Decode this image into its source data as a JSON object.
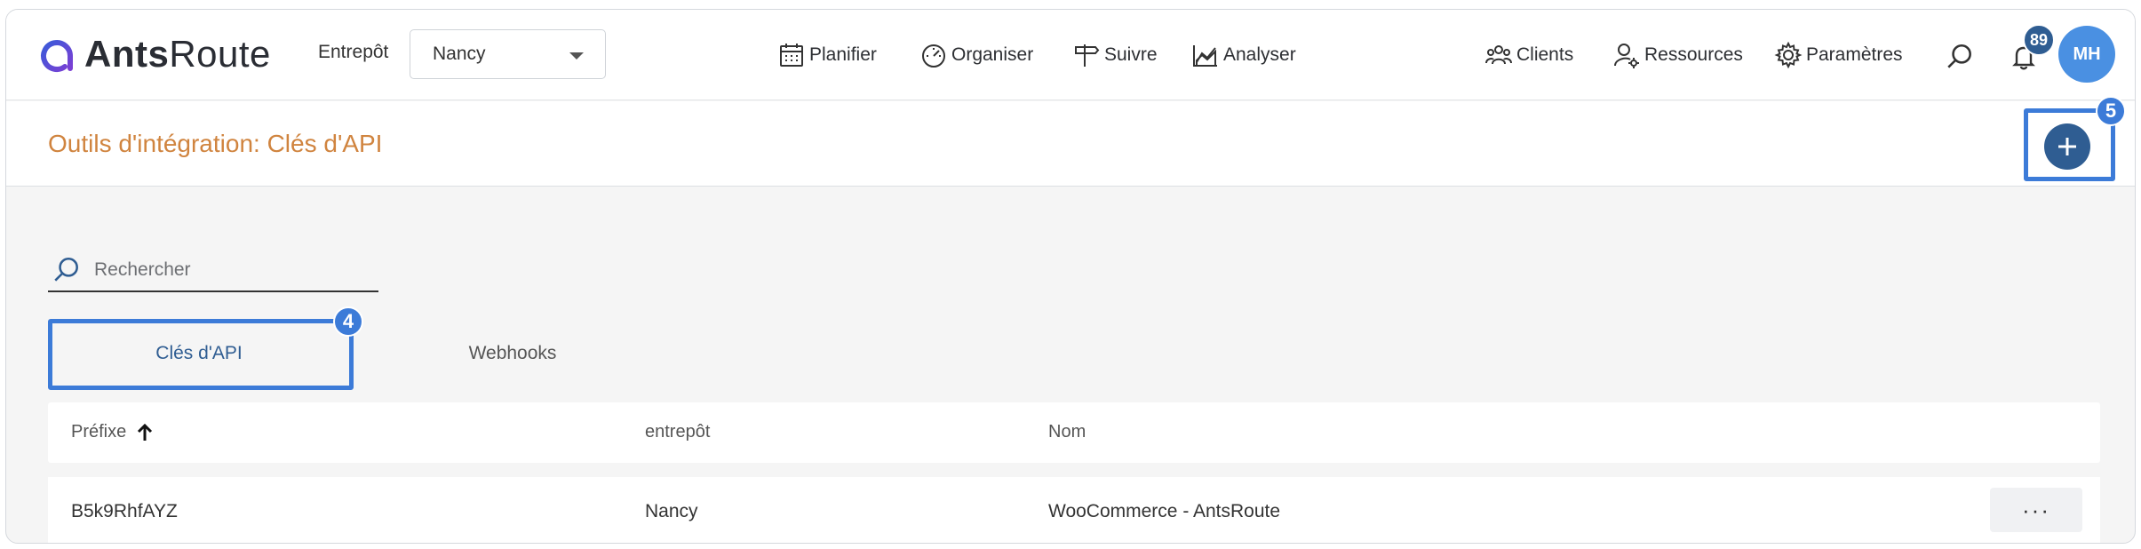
{
  "brand": {
    "logo_bold": "Ants",
    "logo_light": "Route"
  },
  "header": {
    "warehouse_label": "Entrepôt",
    "warehouse_value": "Nancy",
    "nav": [
      {
        "label": "Planifier",
        "icon": "calendar-icon"
      },
      {
        "label": "Organiser",
        "icon": "gauge-icon"
      },
      {
        "label": "Suivre",
        "icon": "signpost-icon"
      },
      {
        "label": "Analyser",
        "icon": "chart-icon"
      }
    ],
    "right_nav": [
      {
        "label": "Clients",
        "icon": "group-icon"
      },
      {
        "label": "Ressources",
        "icon": "user-gear-icon"
      },
      {
        "label": "Paramètres",
        "icon": "gear-icon"
      }
    ],
    "notification_count": "89",
    "avatar_initials": "MH"
  },
  "page": {
    "title": "Outils d'intégration: Clés d'API",
    "add_annotation": "5"
  },
  "search": {
    "placeholder": "Rechercher",
    "value": ""
  },
  "tabs": [
    {
      "label": "Clés d'API",
      "active": true,
      "annotation": "4"
    },
    {
      "label": "Webhooks",
      "active": false
    }
  ],
  "table": {
    "columns": [
      "Préfixe",
      "entrepôt",
      "Nom"
    ],
    "sort_column": "Préfixe",
    "sort_direction": "asc",
    "rows": [
      {
        "prefix": "B5k9RhfAYZ",
        "warehouse": "Nancy",
        "name": "WooCommerce - AntsRoute",
        "actions": "···"
      }
    ]
  },
  "colors": {
    "accent": "#2f5d92",
    "title": "#d0843f",
    "highlight": "#3c7bd8",
    "avatar": "#4a90e2"
  }
}
